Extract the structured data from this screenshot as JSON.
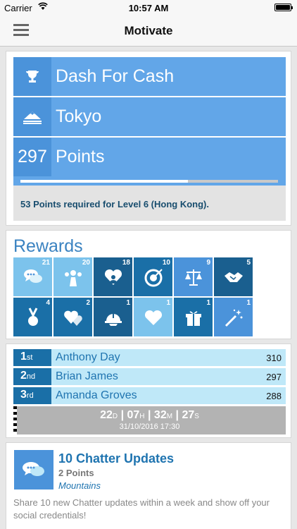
{
  "status": {
    "carrier": "Carrier",
    "time": "10:57 AM"
  },
  "nav": {
    "title": "Motivate"
  },
  "motivation": {
    "challenge": "Dash For Cash",
    "location": "Tokyo",
    "points_value": "297",
    "points_label": "Points",
    "progress_fraction": 0.65,
    "level_text": "53 Points required for Level 6 (Hong Kong)."
  },
  "rewards": {
    "title": "Rewards",
    "tiles": [
      {
        "icon": "chat-bubbles-icon",
        "count": "21",
        "color": "#7cc3ec"
      },
      {
        "icon": "team-icon",
        "count": "20",
        "color": "#7cc3ec"
      },
      {
        "icon": "heart-person-icon",
        "count": "18",
        "color": "#1a5f8f"
      },
      {
        "icon": "target-icon",
        "count": "10",
        "color": "#1a6fa7"
      },
      {
        "icon": "scales-icon",
        "count": "9",
        "color": "#4b93da"
      },
      {
        "icon": "handshake-icon",
        "count": "5",
        "color": "#1a5f8f"
      },
      {
        "icon": "medal-icon",
        "count": "4",
        "color": "#1a6fa7"
      },
      {
        "icon": "hearts-icon",
        "count": "2",
        "color": "#1a6fa7"
      },
      {
        "icon": "hardhat-icon",
        "count": "1",
        "color": "#1a5f8f"
      },
      {
        "icon": "heart-stack-icon",
        "count": "1",
        "color": "#7cc3ec"
      },
      {
        "icon": "gift-icon",
        "count": "1",
        "color": "#1a6fa7"
      },
      {
        "icon": "magic-wand-icon",
        "count": "1",
        "color": "#4b93da"
      }
    ]
  },
  "leaderboard": {
    "rows": [
      {
        "rank": "1",
        "suffix": "st",
        "name": "Anthony Day",
        "score": "310"
      },
      {
        "rank": "2",
        "suffix": "nd",
        "name": "Brian James",
        "score": "297"
      },
      {
        "rank": "3",
        "suffix": "rd",
        "name": "Amanda Groves",
        "score": "288"
      }
    ],
    "countdown": {
      "days": "22",
      "d_unit": "D",
      "hours": "07",
      "h_unit": "H",
      "minutes": "32",
      "m_unit": "M",
      "seconds": "27",
      "s_unit": "S",
      "end_date": "31/10/2016 17:30"
    }
  },
  "chatter": {
    "title": "10 Chatter Updates",
    "points": "2 Points",
    "location": "Mountains",
    "description": "Share 10 new Chatter updates within a week and show off your social credentials!"
  }
}
